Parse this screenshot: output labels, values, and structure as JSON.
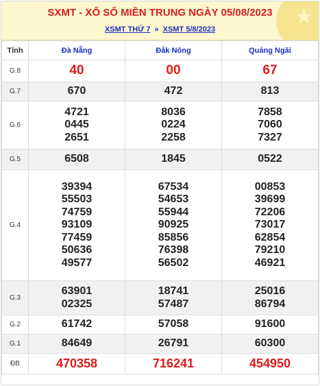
{
  "header": {
    "title": "SXMT - XỔ SỐ MIỀN TRUNG NGÀY 05/08/2023",
    "link1": "XSMT THỨ 7",
    "separator": "»",
    "link2": "XSMT 5/8/2023",
    "decoration_icon": "star-icon"
  },
  "table": {
    "label_header": "Tỉnh",
    "provinces": [
      "Đà Nẵng",
      "Đắk Nông",
      "Quảng Ngãi"
    ],
    "rows": [
      {
        "label": "G.8",
        "values": [
          [
            "40"
          ],
          [
            "00"
          ],
          [
            "67"
          ]
        ]
      },
      {
        "label": "G.7",
        "values": [
          [
            "670"
          ],
          [
            "472"
          ],
          [
            "813"
          ]
        ]
      },
      {
        "label": "G.6",
        "values": [
          [
            "4721",
            "0445",
            "2651"
          ],
          [
            "8036",
            "0224",
            "2258"
          ],
          [
            "7858",
            "7060",
            "7327"
          ]
        ]
      },
      {
        "label": "G.5",
        "values": [
          [
            "6508"
          ],
          [
            "1845"
          ],
          [
            "0522"
          ]
        ]
      },
      {
        "label": "G.4",
        "values": [
          [
            "39394",
            "55503",
            "74759",
            "93109",
            "77459",
            "50636",
            "49577"
          ],
          [
            "67534",
            "54653",
            "55944",
            "90925",
            "85856",
            "76398",
            "56502"
          ],
          [
            "00853",
            "39699",
            "72206",
            "73017",
            "62854",
            "79210",
            "46921"
          ]
        ]
      },
      {
        "label": "G.3",
        "values": [
          [
            "63901",
            "02325"
          ],
          [
            "18741",
            "57487"
          ],
          [
            "25016",
            "86794"
          ]
        ]
      },
      {
        "label": "G.2",
        "values": [
          [
            "61742"
          ],
          [
            "57058"
          ],
          [
            "91600"
          ]
        ]
      },
      {
        "label": "G.1",
        "values": [
          [
            "84649"
          ],
          [
            "26791"
          ],
          [
            "60300"
          ]
        ]
      },
      {
        "label": "ĐB",
        "values": [
          [
            "470358"
          ],
          [
            "716241"
          ],
          [
            "454950"
          ]
        ]
      }
    ]
  },
  "colors": {
    "header_bg": "#fdf6cf",
    "title": "#d0211c",
    "link": "#1d2fbf",
    "prize_red": "#e0191a",
    "alt_row": "#f1f1f1"
  }
}
